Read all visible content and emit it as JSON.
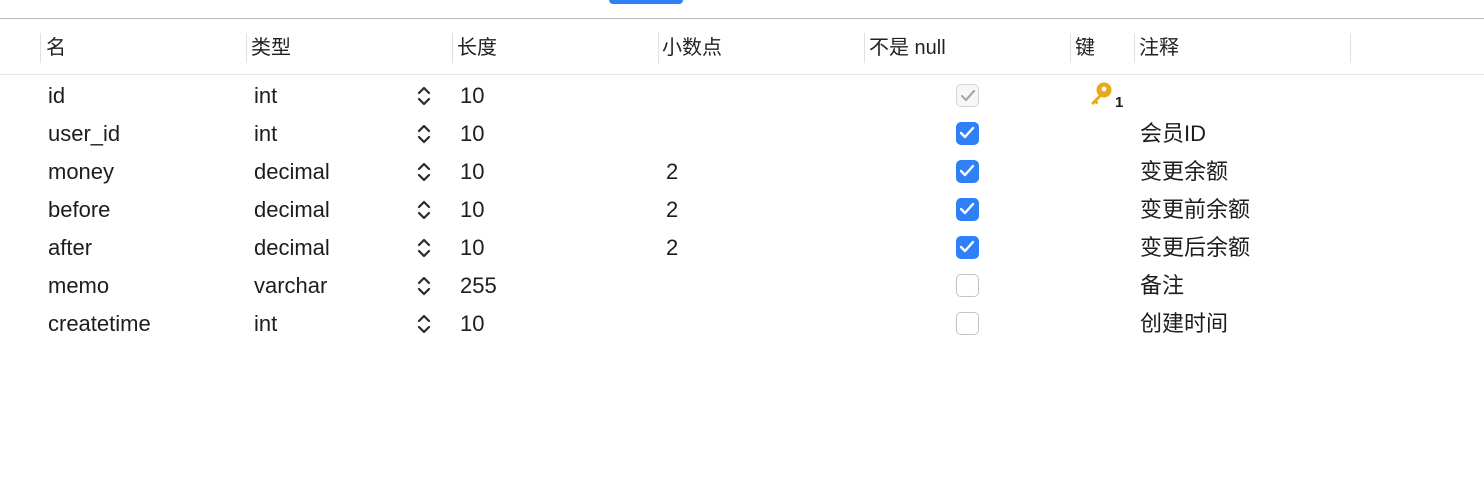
{
  "columns": {
    "name": "名",
    "type": "类型",
    "length": "长度",
    "decimals": "小数点",
    "not_null": "不是 null",
    "key": "键",
    "comment": "注释"
  },
  "rows": [
    {
      "name": "id",
      "type": "int",
      "length": "10",
      "decimals": "",
      "not_null": true,
      "not_null_disabled": true,
      "key": "1",
      "comment": ""
    },
    {
      "name": "user_id",
      "type": "int",
      "length": "10",
      "decimals": "",
      "not_null": true,
      "key": "",
      "comment": "会员ID"
    },
    {
      "name": "money",
      "type": "decimal",
      "length": "10",
      "decimals": "2",
      "not_null": true,
      "key": "",
      "comment": "变更余额"
    },
    {
      "name": "before",
      "type": "decimal",
      "length": "10",
      "decimals": "2",
      "not_null": true,
      "key": "",
      "comment": "变更前余额"
    },
    {
      "name": "after",
      "type": "decimal",
      "length": "10",
      "decimals": "2",
      "not_null": true,
      "key": "",
      "comment": "变更后余额"
    },
    {
      "name": "memo",
      "type": "varchar",
      "length": "255",
      "decimals": "",
      "not_null": false,
      "key": "",
      "comment": "备注"
    },
    {
      "name": "createtime",
      "type": "int",
      "length": "10",
      "decimals": "",
      "not_null": false,
      "key": "",
      "comment": "创建时间"
    }
  ],
  "icons": {
    "type_stepper": "chevron-up-down-icon",
    "primary_key": "key-icon"
  },
  "colors": {
    "accent": "#2f7ff7",
    "key_gold": "#e8a817"
  }
}
